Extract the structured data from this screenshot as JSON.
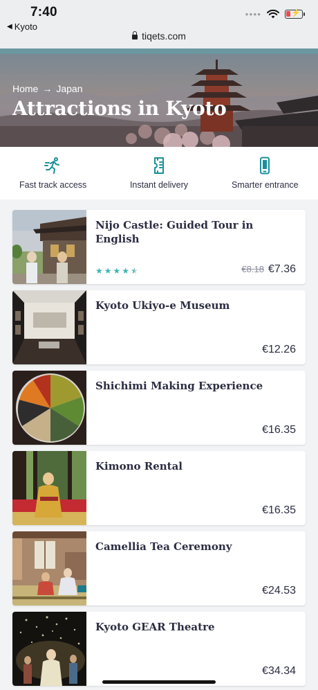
{
  "status": {
    "time": "7:40",
    "back_label": "Kyoto"
  },
  "browser": {
    "url": "tiqets.com"
  },
  "hero": {
    "breadcrumb": [
      "Home",
      "Japan"
    ],
    "title": "Attractions in Kyoto"
  },
  "features": [
    {
      "label": "Fast track access",
      "icon": "running-person-icon"
    },
    {
      "label": "Instant delivery",
      "icon": "ticket-phone-icon"
    },
    {
      "label": "Smarter entrance",
      "icon": "smartphone-icon"
    }
  ],
  "colors": {
    "accent": "#3fb5b3",
    "icon_teal": "#1a8f9a",
    "text": "#2b2d42"
  },
  "attractions": [
    {
      "title": "Nijo Castle: Guided Tour in English",
      "old_price": "€8.18",
      "price": "€7.36",
      "rating": 4.5
    },
    {
      "title": "Kyoto Ukiyo-e Museum",
      "old_price": "",
      "price": "€12.26"
    },
    {
      "title": "Shichimi Making Experience",
      "old_price": "",
      "price": "€16.35"
    },
    {
      "title": "Kimono Rental",
      "old_price": "",
      "price": "€16.35"
    },
    {
      "title": "Camellia Tea Ceremony",
      "old_price": "",
      "price": "€24.53"
    },
    {
      "title": "Kyoto GEAR Theatre",
      "old_price": "",
      "price": "€34.34"
    }
  ]
}
